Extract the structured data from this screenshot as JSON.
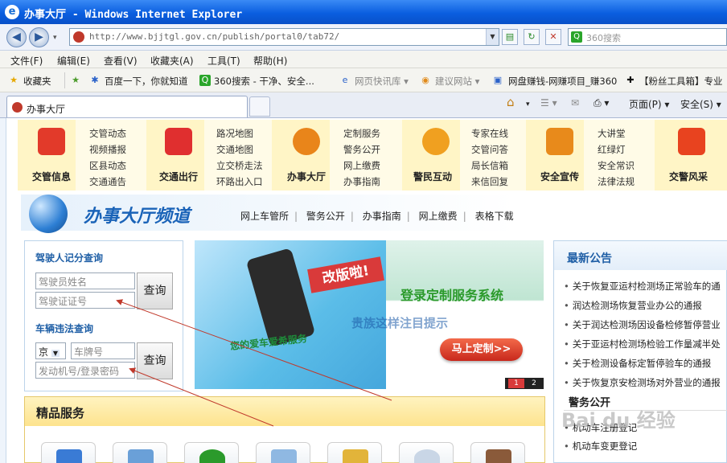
{
  "window": {
    "title": "办事大厅 - Windows Internet Explorer"
  },
  "address": {
    "url": "http://www.bjjtgl.gov.cn/publish/portal0/tab72/"
  },
  "search": {
    "placeholder": "360搜索"
  },
  "menu": [
    "文件(F)",
    "编辑(E)",
    "查看(V)",
    "收藏夹(A)",
    "工具(T)",
    "帮助(H)"
  ],
  "favorites": {
    "label": "收藏夹",
    "items": [
      "百度一下，你就知道",
      "360搜索 - 干净、安全...",
      "网页快讯库 ▾",
      "建议网站 ▾",
      "网盘赚钱-网赚项目_赚360",
      "【粉丝工具箱】专业"
    ]
  },
  "tab": {
    "title": "办事大厅"
  },
  "commandbar": {
    "page": "页面(P) ▾",
    "safety": "安全(S) ▾"
  },
  "topnav": [
    {
      "label": "交管信息",
      "links": [
        "交管动态",
        "视频播报",
        "区县动态",
        "交通通告"
      ],
      "color": "#e23a2a"
    },
    {
      "label": "交通出行",
      "links": [
        "路况地图",
        "交通地图",
        "立交桥走法",
        "环路出入口"
      ],
      "color": "#e02f2f"
    },
    {
      "label": "办事大厅",
      "links": [
        "定制服务",
        "警务公开",
        "网上缴费",
        "办事指南"
      ],
      "color": "#e9851a"
    },
    {
      "label": "警民互动",
      "links": [
        "专家在线",
        "交管问答",
        "局长信箱",
        "来信回复"
      ],
      "color": "#f0a020"
    },
    {
      "label": "安全宣传",
      "links": [
        "大讲堂",
        "红绿灯",
        "安全常识",
        "法律法规"
      ],
      "color": "#e88a1b"
    },
    {
      "label": "交警风采",
      "links": [],
      "color": "#e8431f"
    }
  ],
  "banner": {
    "title": "办事大厅频道",
    "links": [
      "网上车管所",
      "警务公开",
      "办事指南",
      "网上缴费",
      "表格下载"
    ]
  },
  "query": {
    "score_title": "驾驶人记分查询",
    "driver_name_placeholder": "驾驶员姓名",
    "license_placeholder": "驾驶证证号",
    "query_label": "查询",
    "violation_title": "车辆违法查询",
    "province": "京",
    "plate_placeholder": "车牌号",
    "engine_placeholder": "发动机号/登录密码"
  },
  "slide": {
    "red_tag": "改版啦!",
    "green_title": "登录定制服务系统",
    "faded_text": "贵族这样注目提示",
    "green_text": "您的爱车爱希服务",
    "cta": "马上定制>>",
    "pages": [
      "1",
      "2"
    ]
  },
  "announcements": {
    "title": "最新公告",
    "items": [
      "关于恢复亚运村检测场正常验车的通",
      "润达检测场恢复营业办公的通报",
      "关于润达检测场因设备检修暂停营业",
      "关于亚运村检测场检验工作量减半处",
      "关于检测设备标定暂停验车的通报",
      "关于恢复京安检测场对外营业的通报"
    ]
  },
  "police_affairs": {
    "title": "警务公开",
    "items": [
      "机动车注册登记",
      "机动车变更登记"
    ]
  },
  "premium": {
    "title": "精品服务"
  },
  "watermark": "Bai du 经验"
}
